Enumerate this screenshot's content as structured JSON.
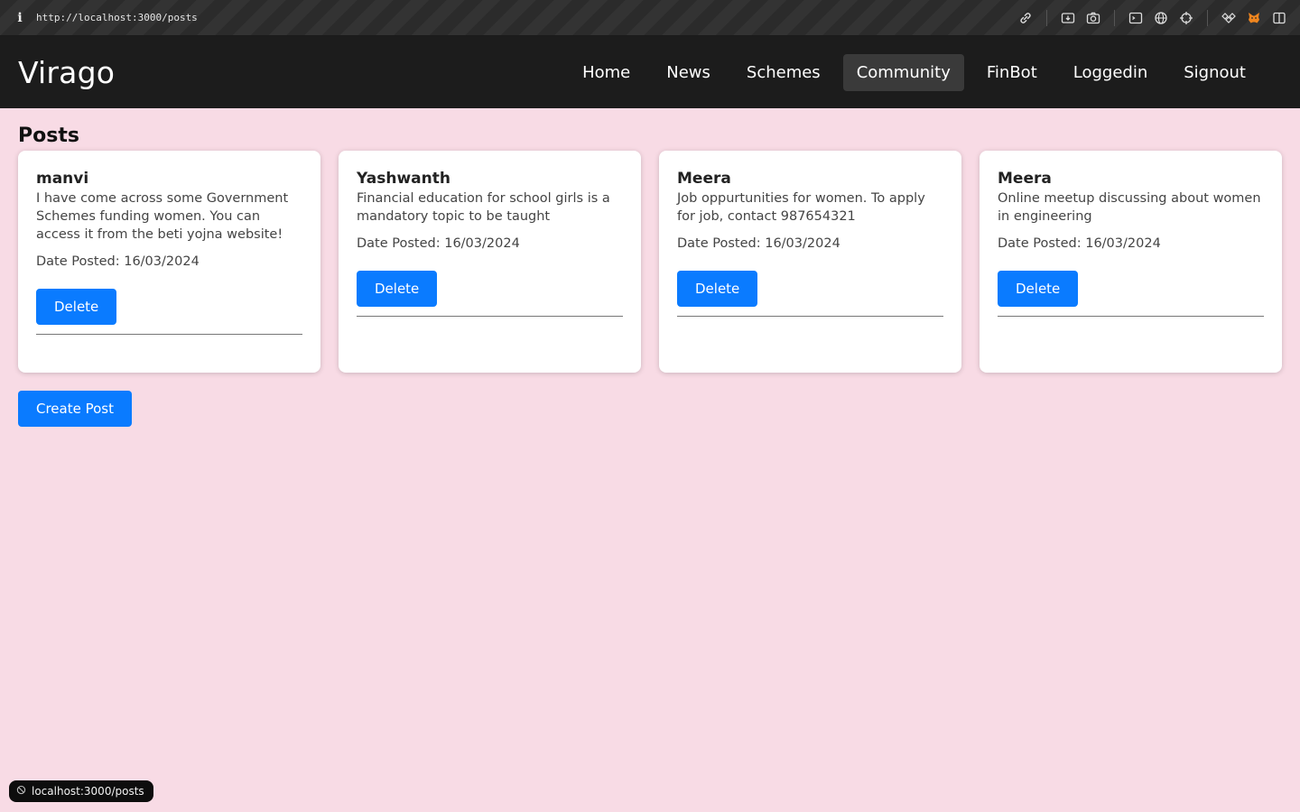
{
  "browser": {
    "info_label": "i",
    "url": "http://localhost:3000/posts",
    "tools": [
      "link-icon",
      "screenshot-icon",
      "camera-icon",
      "terminal-icon",
      "globe-icon",
      "crosshair-icon",
      "extensions-icon",
      "metamask-icon",
      "sidebar-icon"
    ]
  },
  "navbar": {
    "brand": "Virago",
    "items": [
      {
        "label": "Home"
      },
      {
        "label": "News"
      },
      {
        "label": "Schemes"
      },
      {
        "label": "Community",
        "active": true
      },
      {
        "label": "FinBot"
      },
      {
        "label": "Loggedin"
      },
      {
        "label": "Signout"
      }
    ]
  },
  "main": {
    "title": "Posts",
    "posts": [
      {
        "author": "manvi",
        "content": "I have come across some Government Schemes funding women. You can access it from the beti yojna website!",
        "date": "Date Posted: 16/03/2024",
        "delete_label": "Delete"
      },
      {
        "author": "Yashwanth",
        "content": "Financial education for school girls is a mandatory topic to be taught",
        "date": "Date Posted: 16/03/2024",
        "delete_label": "Delete"
      },
      {
        "author": "Meera",
        "content": "Job oppurtunities for women. To apply for job, contact 987654321",
        "date": "Date Posted: 16/03/2024",
        "delete_label": "Delete"
      },
      {
        "author": "Meera",
        "content": "Online meetup discussing about women in engineering",
        "date": "Date Posted: 16/03/2024",
        "delete_label": "Delete"
      }
    ],
    "create_label": "Create Post"
  },
  "status_bar": {
    "link": "localhost:3000/posts"
  },
  "colors": {
    "page_bg": "#f8dbe5",
    "navbar_bg": "#1c1c1c",
    "primary_button": "#0a7bff"
  }
}
